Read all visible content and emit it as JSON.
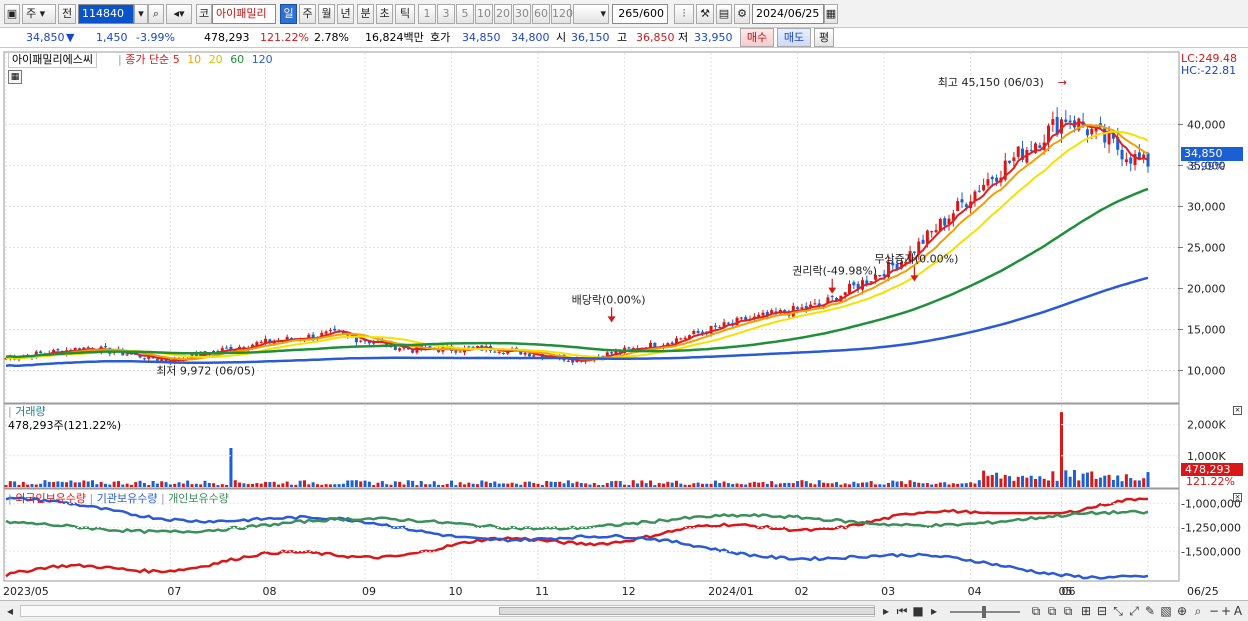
{
  "toolbar": {
    "market": "주",
    "prev": "전",
    "code": "114840",
    "exchange_label": "코",
    "stock_name": "아이패밀리",
    "periods": [
      "일",
      "주",
      "월",
      "년",
      "분",
      "초",
      "틱"
    ],
    "selected_period": "일",
    "intervals": [
      "1",
      "3",
      "5",
      "10",
      "20",
      "30",
      "60",
      "120"
    ],
    "count": "265",
    "count_max": "/600",
    "date": "2024/06/25"
  },
  "quote": {
    "price": "34,850",
    "change": "1,450",
    "change_pct": "-3.99%",
    "volume": "478,293",
    "volume_ratio": "121.22%",
    "turnover": "2.78%",
    "amount": "16,824백만",
    "bid_label": "호가",
    "ask": "34,850",
    "bid": "34,800",
    "open_label": "시",
    "open": "36,150",
    "high_label": "고",
    "high": "36,850",
    "low_label": "저",
    "low": "33,950",
    "buy_label": "매수",
    "sell_label": "매도",
    "eval_label": "평"
  },
  "price_panel": {
    "title": "아이패밀리에스씨",
    "legend_label": "종가 단순",
    "ma_periods": [
      "5",
      "10",
      "20",
      "60",
      "120"
    ],
    "ma_colors": [
      "#e02020",
      "#f0a000",
      "#f4e100",
      "#1f8f3a",
      "#2a5ad6"
    ],
    "lc": "LC:249.48",
    "hc": "HC:-22.81",
    "y_ticks": [
      "40,000",
      "35,000",
      "30,000",
      "25,000",
      "20,000",
      "15,000",
      "10,000"
    ],
    "current_price": "34,850",
    "current_pct": "-3.99%",
    "high_annotation": "최고 45,150 (06/03)",
    "low_annotation": "최저 9,972 (06/05)",
    "events": [
      "배당락(0.00%)",
      "권리락(-49.98%)",
      "무상증자(0.00%)"
    ]
  },
  "volume_panel": {
    "title": "거래량",
    "value_text": "478,293주(121.22%)",
    "y_ticks": [
      "2,000K",
      "1,000K"
    ],
    "current": "478,293",
    "current_pct": "121.22%"
  },
  "holding_panel": {
    "series": [
      "외국인보유수량",
      "기관보유수량",
      "개인보유수량"
    ],
    "series_colors": [
      "#d81818",
      "#2a5ad6",
      "#3a8f5a"
    ],
    "y_ticks": [
      "-1,000,000",
      "-1,250,000",
      "-1,500,000"
    ]
  },
  "x_axis": {
    "labels": [
      "2023/05",
      "07",
      "08",
      "09",
      "10",
      "11",
      "12",
      "2024/01",
      "02",
      "03",
      "04",
      "05",
      "06",
      "06/25"
    ]
  },
  "chart_data": [
    {
      "type": "candlestick",
      "title": "아이패밀리에스씨",
      "x_range": [
        "2023/05",
        "2024/06/25"
      ],
      "ylim": [
        7500,
        47000
      ],
      "high_point": {
        "value": 45150,
        "date": "06/03"
      },
      "low_point": {
        "value": 9972,
        "date": "06/05"
      },
      "close_series_monthly": [
        {
          "x": "2023/05",
          "y": 11500
        },
        {
          "x": "2023/06",
          "y": 12800
        },
        {
          "x": "2023/07",
          "y": 11200
        },
        {
          "x": "2023/08",
          "y": 13200
        },
        {
          "x": "2023/09",
          "y": 14500
        },
        {
          "x": "2023/10",
          "y": 12500
        },
        {
          "x": "2023/11",
          "y": 12700
        },
        {
          "x": "2023/12",
          "y": 11300
        },
        {
          "x": "2024/01",
          "y": 13200
        },
        {
          "x": "2024/02",
          "y": 16000
        },
        {
          "x": "2024/03",
          "y": 18000
        },
        {
          "x": "2024/04",
          "y": 23500
        },
        {
          "x": "2024/05",
          "y": 33000
        },
        {
          "x": "2024/06",
          "y": 41000
        },
        {
          "x": "2024/06/25",
          "y": 34850
        }
      ],
      "moving_averages": [
        {
          "name": "5",
          "last": 37000
        },
        {
          "name": "10",
          "last": 38500
        },
        {
          "name": "20",
          "last": 39000
        },
        {
          "name": "60",
          "last": 31000
        },
        {
          "name": "120",
          "last": 23500
        }
      ]
    },
    {
      "type": "bar",
      "title": "거래량",
      "ylim": [
        0,
        2500000
      ],
      "last": 478293,
      "peak": 2400000
    },
    {
      "type": "line",
      "series": [
        {
          "name": "외국인보유수량",
          "start": -1750000,
          "end": -1000000
        },
        {
          "name": "기관보유수량",
          "start": -1000000,
          "end": -1750000
        },
        {
          "name": "개인보유수량",
          "start": -1250000,
          "end": -1150000
        }
      ],
      "ylim": [
        -1800000,
        -900000
      ]
    }
  ]
}
